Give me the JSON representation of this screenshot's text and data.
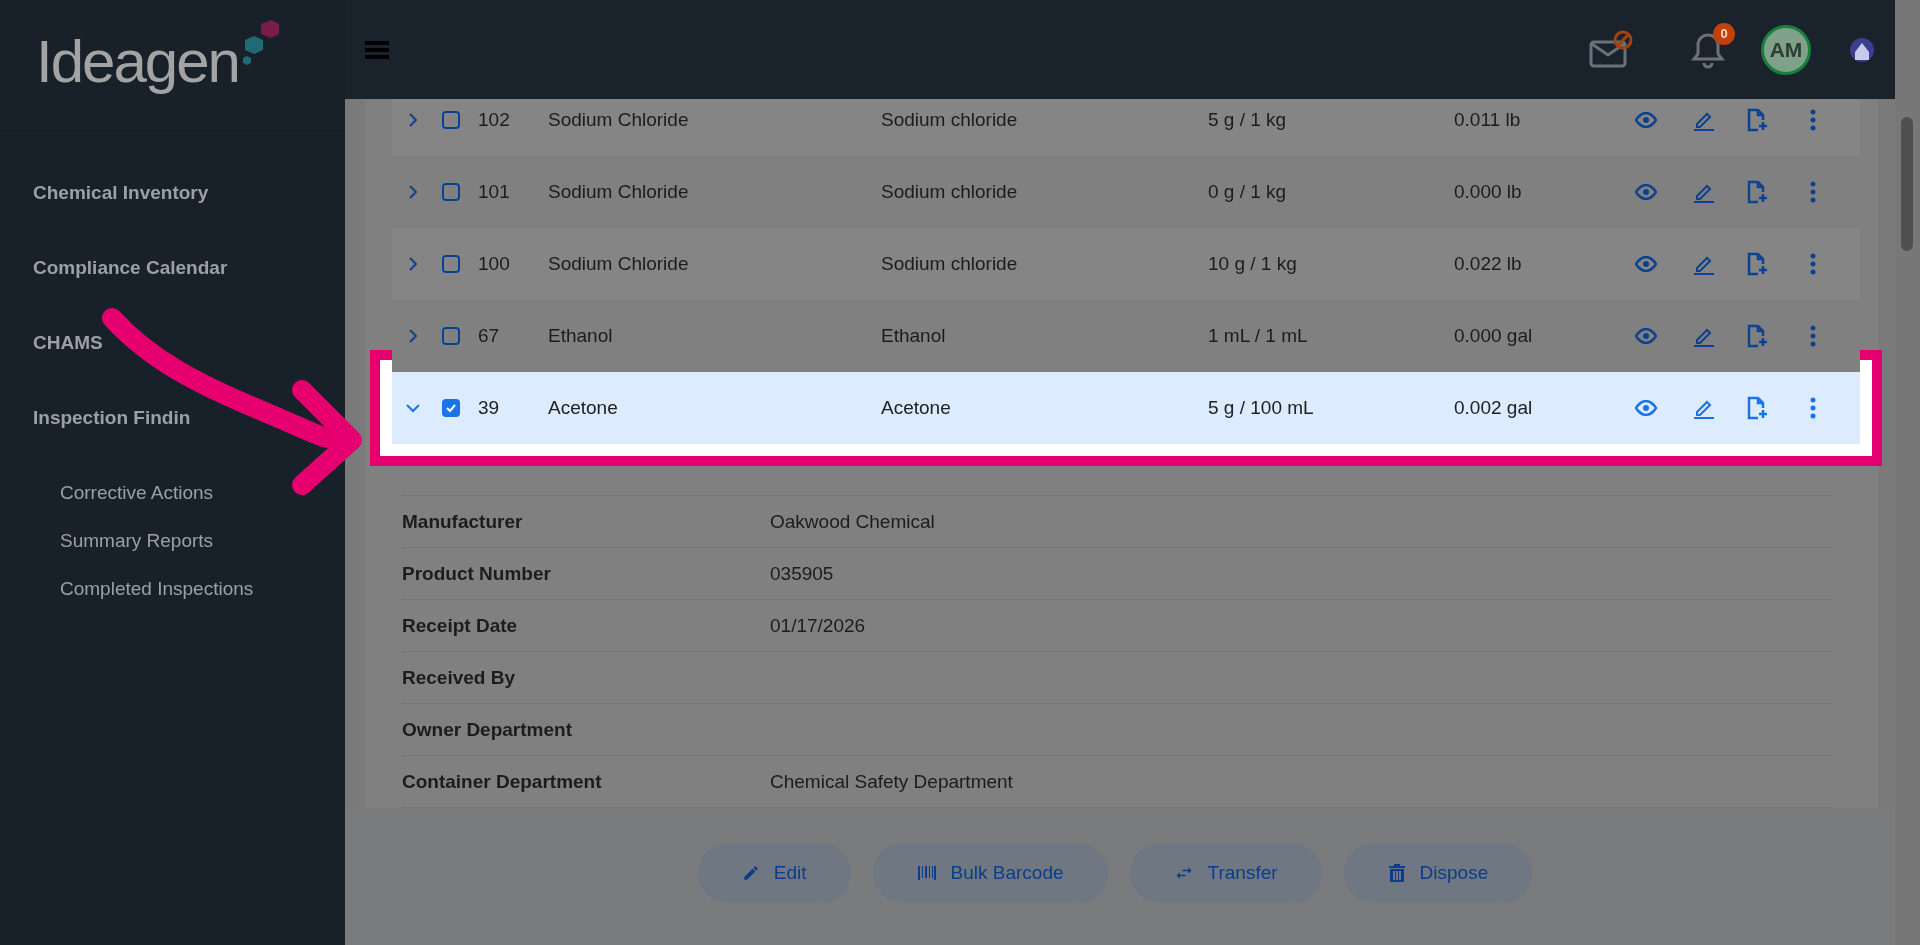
{
  "app": {
    "logo": "Ideagen"
  },
  "topbar": {
    "notification_count": "0",
    "avatar": "AM"
  },
  "sidebar": {
    "items": [
      {
        "label": "Chemical Inventory"
      },
      {
        "label": "Compliance Calendar"
      },
      {
        "label": "CHAMS"
      },
      {
        "label": "Inspection Findin",
        "children": [
          {
            "label": "Corrective Actions"
          },
          {
            "label": "Summary Reports"
          },
          {
            "label": "Completed Inspections"
          }
        ]
      }
    ]
  },
  "table": {
    "rows": [
      {
        "id": "102",
        "name": "Sodium Chloride",
        "chemical": "Sodium chloride",
        "amount": "5 g / 1 kg",
        "quantity": "0.011 lb",
        "expanded": false,
        "checked": false,
        "highlighted": false
      },
      {
        "id": "101",
        "name": "Sodium Chloride",
        "chemical": "Sodium chloride",
        "amount": "0 g / 1 kg",
        "quantity": "0.000 lb",
        "expanded": false,
        "checked": false,
        "highlighted": false
      },
      {
        "id": "100",
        "name": "Sodium Chloride",
        "chemical": "Sodium chloride",
        "amount": "10 g / 1 kg",
        "quantity": "0.022 lb",
        "expanded": false,
        "checked": false,
        "highlighted": false
      },
      {
        "id": "67",
        "name": "Ethanol",
        "chemical": "Ethanol",
        "amount": "1 mL / 1 mL",
        "quantity": "0.000 gal",
        "expanded": false,
        "checked": false,
        "highlighted": false
      },
      {
        "id": "39",
        "name": "Acetone",
        "chemical": "Acetone",
        "amount": "5 g / 100 mL",
        "quantity": "0.002 gal",
        "expanded": true,
        "checked": true,
        "highlighted": true
      }
    ]
  },
  "details": [
    {
      "label": "Manufacturer",
      "value": "Oakwood Chemical"
    },
    {
      "label": "Product Number",
      "value": "035905"
    },
    {
      "label": "Receipt Date",
      "value": "01/17/2026"
    },
    {
      "label": "Received By"
    },
    {
      "label": "Owner Department"
    },
    {
      "label": "Container Department",
      "value": "Chemical Safety Department"
    }
  ],
  "actions": [
    {
      "label": "Edit",
      "kind": "edit"
    },
    {
      "label": "Bulk Barcode",
      "kind": "barcode"
    },
    {
      "label": "Transfer",
      "kind": "transfer"
    },
    {
      "label": "Dispose",
      "kind": "dispose"
    }
  ]
}
